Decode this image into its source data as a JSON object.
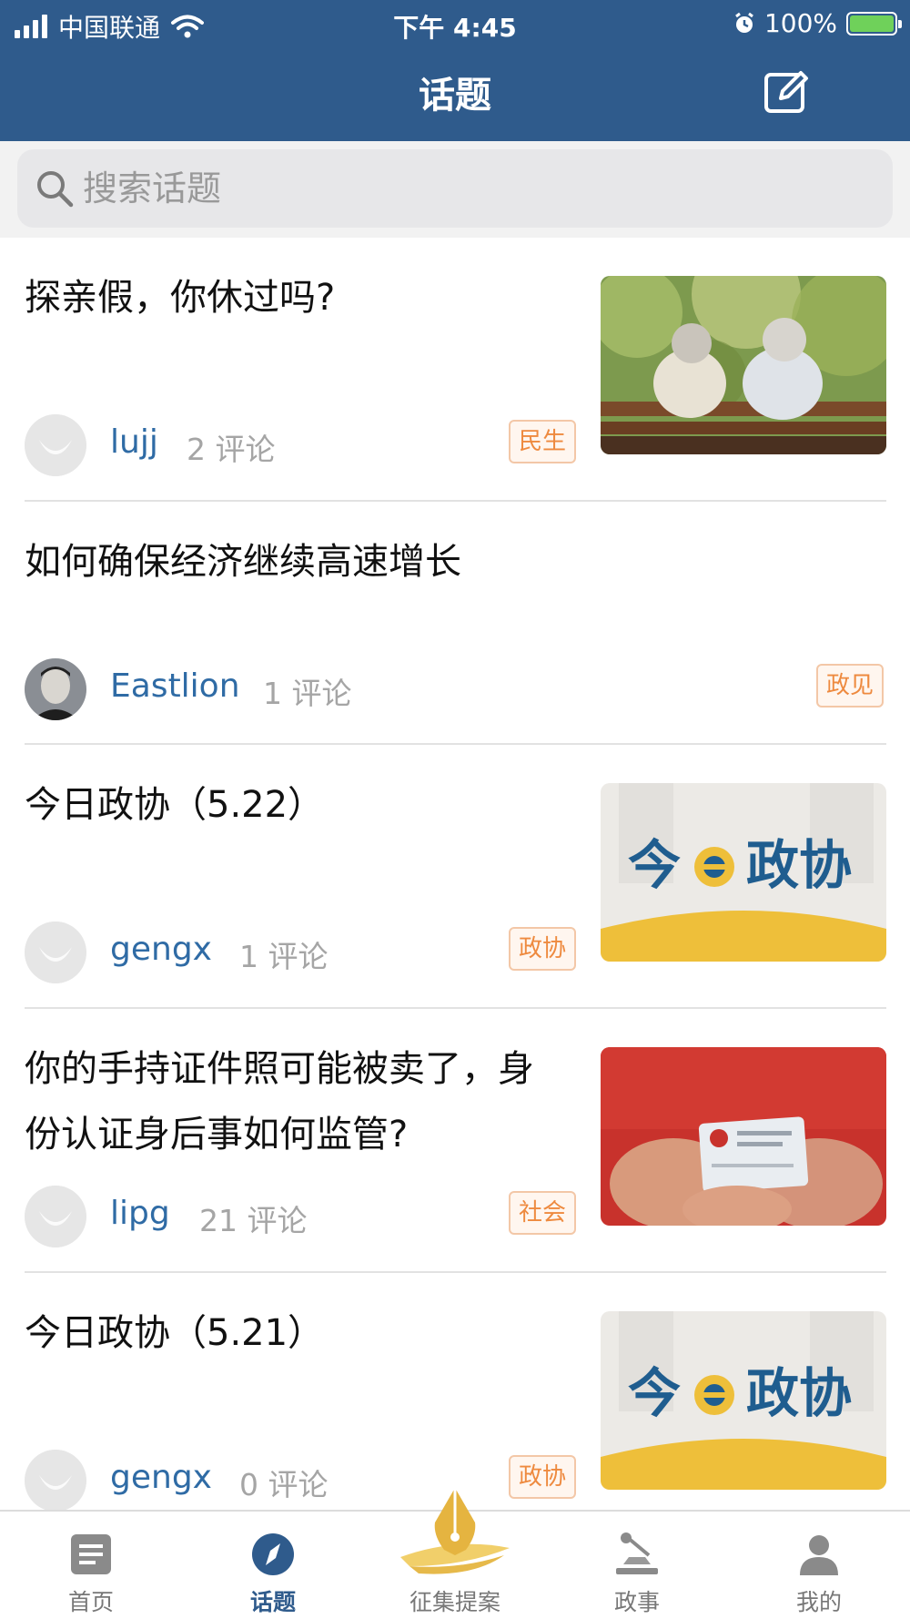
{
  "status_bar": {
    "carrier": "中国联通",
    "time": "下午 4:45",
    "battery": "100%"
  },
  "nav": {
    "title": "话题"
  },
  "search": {
    "placeholder": "搜索话题"
  },
  "topics": [
    {
      "title": "探亲假，你休过吗?",
      "author": "lujj",
      "comments": "2 评论",
      "tag": "民生"
    },
    {
      "title": "如何确保经济继续高速增长",
      "author": "Eastlion",
      "comments": "1 评论",
      "tag": "政见"
    },
    {
      "title": "今日政协（5.22）",
      "author": "gengx",
      "comments": "1 评论",
      "tag": "政协",
      "thumb_text": [
        "今",
        "政协"
      ]
    },
    {
      "title": "你的手持证件照可能被卖了，身份认证身后事如何监管?",
      "author": "lipg",
      "comments": "21 评论",
      "tag": "社会"
    },
    {
      "title": "今日政协（5.21）",
      "author": "gengx",
      "comments": "0 评论",
      "tag": "政协",
      "thumb_text": [
        "今",
        "政协"
      ]
    }
  ],
  "tabbar": {
    "items": [
      {
        "label": "首页",
        "icon": "document-icon"
      },
      {
        "label": "话题",
        "icon": "compass-icon",
        "active": true
      },
      {
        "label": "征集提案",
        "icon": "pen-nib-icon"
      },
      {
        "label": "政事",
        "icon": "microphone-icon"
      },
      {
        "label": "我的",
        "icon": "person-icon"
      }
    ]
  },
  "colors": {
    "header": "#2f5b8c",
    "link": "#2f6ba5",
    "tag_text": "#ee8a3f",
    "tag_border": "#f3c7a7"
  }
}
